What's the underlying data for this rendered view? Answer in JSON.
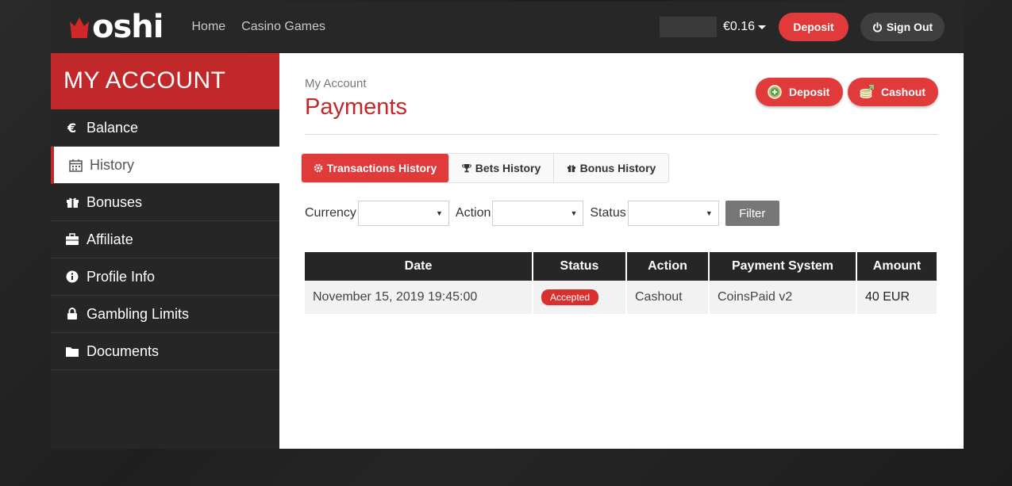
{
  "header": {
    "logo_text": "oshi",
    "nav": [
      "Home",
      "Casino Games"
    ],
    "balance": "€0.16",
    "deposit_label": "Deposit",
    "signout_label": "Sign Out"
  },
  "sidebar": {
    "title": "MY ACCOUNT",
    "items": [
      {
        "label": "Balance",
        "icon": "euro-icon"
      },
      {
        "label": "History",
        "icon": "calendar-icon"
      },
      {
        "label": "Bonuses",
        "icon": "gift-icon"
      },
      {
        "label": "Affiliate",
        "icon": "briefcase-icon"
      },
      {
        "label": "Profile Info",
        "icon": "info-icon"
      },
      {
        "label": "Gambling Limits",
        "icon": "lock-icon"
      },
      {
        "label": "Documents",
        "icon": "folder-icon"
      }
    ],
    "active_index": 1
  },
  "main": {
    "breadcrumb": "My Account",
    "title": "Payments",
    "deposit_label": "Deposit",
    "cashout_label": "Cashout",
    "tabs": [
      {
        "label": "Transactions History",
        "icon": "gear-icon"
      },
      {
        "label": "Bets History",
        "icon": "trophy-icon"
      },
      {
        "label": "Bonus History",
        "icon": "gift-icon"
      }
    ],
    "filters": {
      "currency_label": "Currency",
      "action_label": "Action",
      "status_label": "Status",
      "filter_button": "Filter"
    },
    "table": {
      "headers": [
        "Date",
        "Status",
        "Action",
        "Payment System",
        "Amount"
      ],
      "rows": [
        {
          "date": "November 15, 2019 19:45:00",
          "status": "Accepted",
          "action": "Cashout",
          "payment_system": "CoinsPaid v2",
          "amount": "40 EUR"
        }
      ]
    }
  },
  "colors": {
    "accent": "#e03a3a",
    "sidebar_title": "#c0282a",
    "dark": "#262626"
  }
}
